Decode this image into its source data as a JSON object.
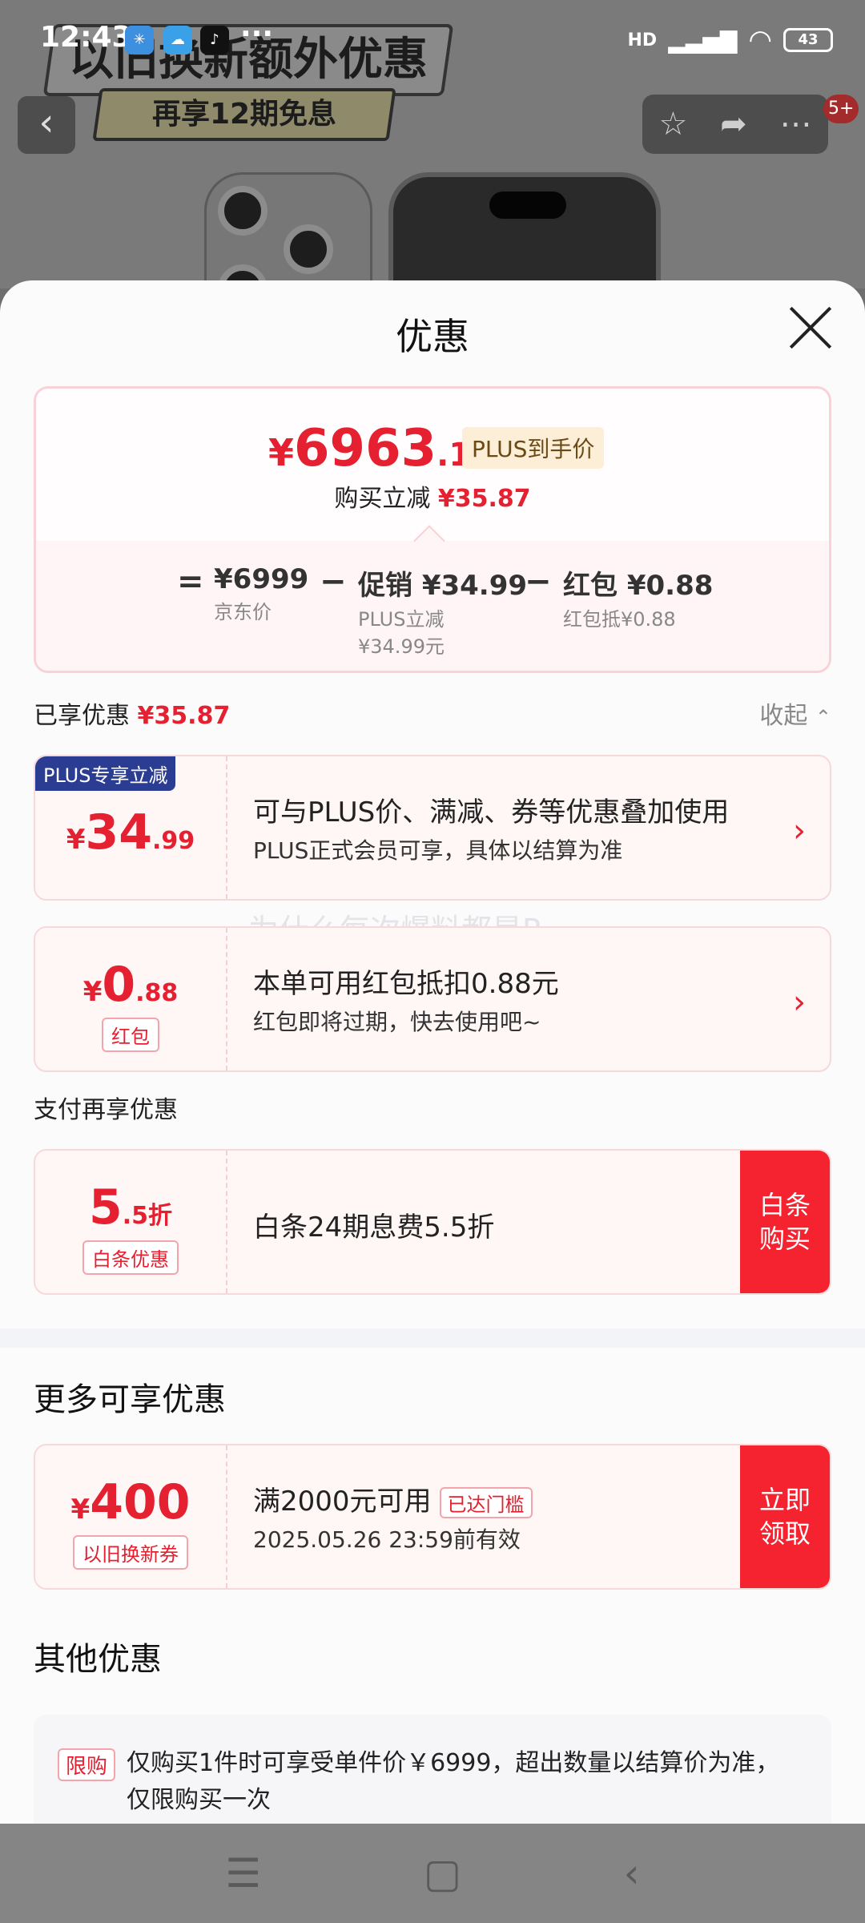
{
  "status_bar": {
    "time": "12:43",
    "dots": "···",
    "battery": "43",
    "signal_label": "HD"
  },
  "background": {
    "banner_title": "以旧换新额外优惠",
    "banner_sub": "再享12期免息",
    "back_icon": "‹",
    "badge": "5+"
  },
  "sheet": {
    "title": "优惠",
    "price": {
      "currency": "¥",
      "integer": "6963",
      "decimal": ".13",
      "tag": "PLUS到手价",
      "reduce_label": "购买立减",
      "reduce_value": "¥35.87"
    },
    "formula": {
      "eq": "=",
      "jd_value": "¥6999",
      "jd_label": "京东价",
      "minus": "−",
      "promo_value": "促销 ¥34.99",
      "promo_label": "PLUS立减",
      "promo_label2": "¥34.99元",
      "redpack_value": "红包 ¥0.88",
      "redpack_label": "红包抵¥0.88"
    },
    "enjoyed": {
      "label": "已享优惠",
      "value": "¥35.87",
      "collapse": "收起"
    },
    "coupons": [
      {
        "badge": "PLUS专享立减",
        "cur": "¥",
        "big": "34",
        "small": ".99",
        "main": "可与PLUS价、满减、券等优惠叠加使用",
        "sub": "PLUS正式会员可享，具体以结算为准"
      },
      {
        "cur": "¥",
        "big": "0",
        "small": ".88",
        "tag": "红包",
        "main": "本单可用红包抵扣0.88元",
        "sub": "红包即将过期，快去使用吧~"
      }
    ],
    "watermark": "为什么每次爆料都是R",
    "pay_section": "支付再享优惠",
    "baitiao": {
      "big": "5",
      "small": ".5折",
      "tag": "白条优惠",
      "main": "白条24期息费5.5折",
      "action": "白条\n购买"
    },
    "more_section": "更多可享优惠",
    "trade_in": {
      "cur": "¥",
      "big": "400",
      "tag": "以旧换新券",
      "main": "满2000元可用",
      "met": "已达门槛",
      "sub": "2025.05.26 23:59前有效",
      "action": "立即\n领取"
    },
    "other_section": "其他优惠",
    "other": {
      "tag": "限购",
      "text": "仅购买1件时可享受单件价￥6999，超出数量以结算价为准，仅限购买一次"
    }
  },
  "nav_icons": [
    "menu-icon",
    "home-icon",
    "back-icon"
  ],
  "colors": {
    "accent": "#e52030",
    "plus_blue": "#2b3d92",
    "action_red": "#f5232f"
  }
}
